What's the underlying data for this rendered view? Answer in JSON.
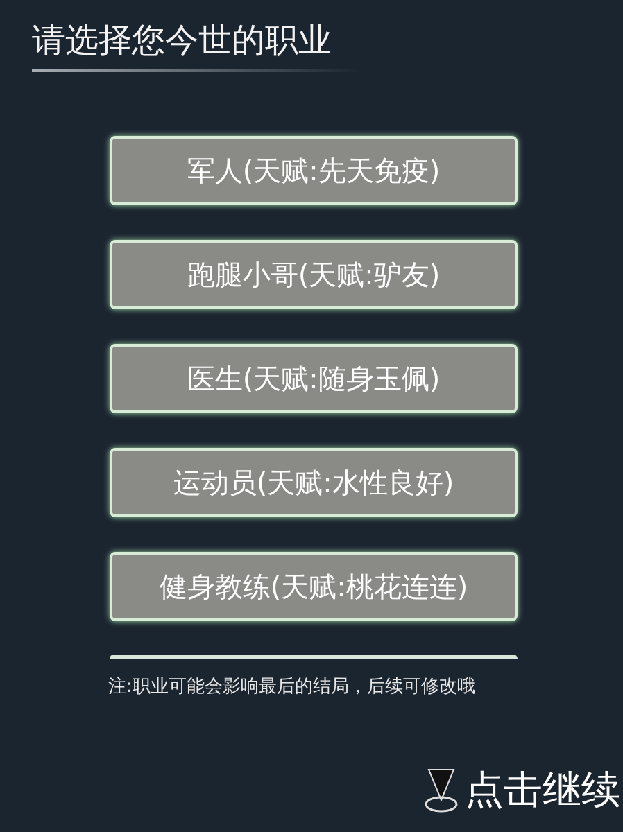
{
  "title": "请选择您今世的职业",
  "careers": [
    {
      "label": "军人(天赋:先天免疫)"
    },
    {
      "label": "跑腿小哥(天赋:驴友)"
    },
    {
      "label": "医生(天赋:随身玉佩)"
    },
    {
      "label": "运动员(天赋:水性良好)"
    },
    {
      "label": "健身教练(天赋:桃花连连)"
    }
  ],
  "note": "注:职业可能会影响最后的结局，后续可修改哦",
  "continue_button": "点击继续"
}
